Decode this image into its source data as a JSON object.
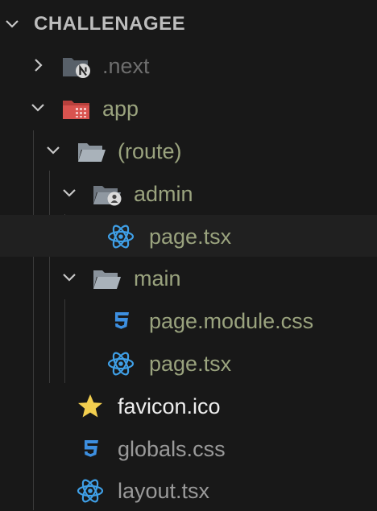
{
  "explorer": {
    "root_label": "CHALLENAGEE",
    "items": [
      {
        "label": ".next",
        "icon": "nextjs-folder-icon"
      },
      {
        "label": "app",
        "icon": "app-folder-icon"
      },
      {
        "label": "(route)",
        "icon": "folder-open-icon"
      },
      {
        "label": "admin",
        "icon": "admin-folder-icon"
      },
      {
        "label": "page.tsx",
        "icon": "react-icon"
      },
      {
        "label": "main",
        "icon": "folder-open-icon"
      },
      {
        "label": "page.module.css",
        "icon": "css-icon"
      },
      {
        "label": "page.tsx",
        "icon": "react-icon"
      },
      {
        "label": "favicon.ico",
        "icon": "star-icon"
      },
      {
        "label": "globals.css",
        "icon": "css-icon"
      },
      {
        "label": "layout.tsx",
        "icon": "react-icon"
      }
    ]
  },
  "colors": {
    "background": "#181818",
    "selected_row": "#202020",
    "modified_text": "#9aa37e",
    "react": "#3f9fe6",
    "css": "#3d8fe0",
    "star": "#f3cf4f",
    "app_folder": "#d9534f"
  }
}
